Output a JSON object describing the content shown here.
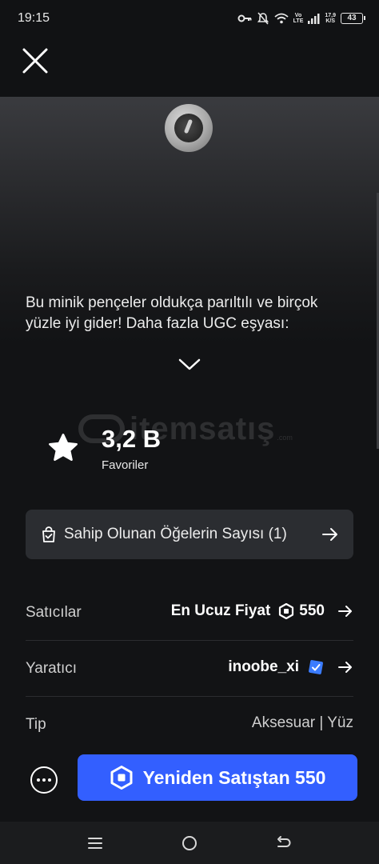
{
  "status_bar": {
    "time": "19:15",
    "signal_label_top": "Vo",
    "signal_label_bottom": "LTE",
    "net_speed_value": "17,9",
    "net_speed_unit": "K/S",
    "battery": "43"
  },
  "item": {
    "description": "Bu minik pençeler oldukça parıltılı ve birçok yüzle iyi gider! Daha fazla UGC eşyası:",
    "favorites_count": "3,2 B",
    "favorites_label": "Favoriler"
  },
  "watermark": {
    "text": "itemsatış",
    "tld": ".com"
  },
  "owned": {
    "label": "Sahip Olunan Öğelerin Sayısı (1)"
  },
  "details": {
    "sellers_label": "Satıcılar",
    "sellers_value": "En Ucuz Fiyat",
    "sellers_price": "550",
    "creator_label": "Yaratıcı",
    "creator_value": "inoobe_xi",
    "type_label": "Tip",
    "type_value": "Aksesuar | Yüz"
  },
  "actions": {
    "buy_label": "Yeniden Satıştan 550"
  },
  "colors": {
    "accent": "#335fff",
    "background": "#121315",
    "card": "#2b2d31",
    "verified": "#3b7cff"
  }
}
